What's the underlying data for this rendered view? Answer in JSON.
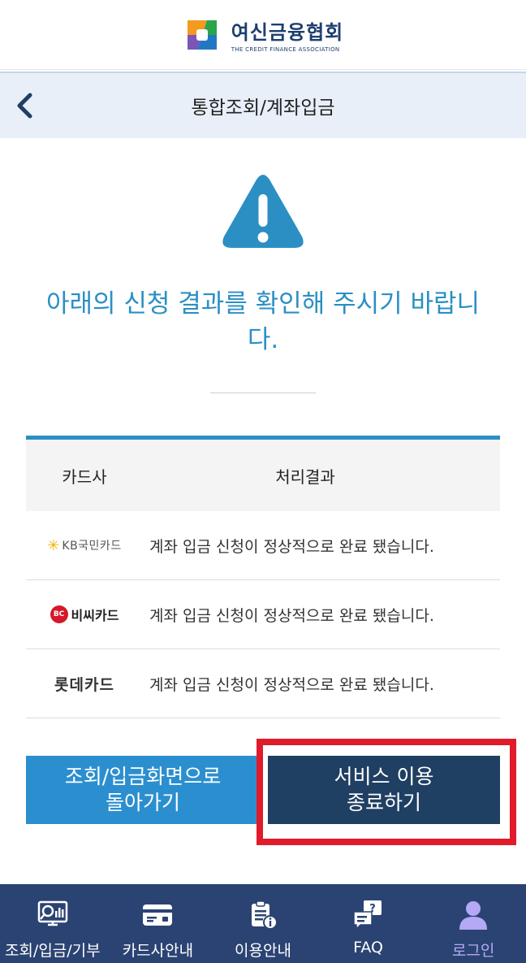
{
  "header": {
    "logo_ko": "여신금융협회",
    "logo_en": "THE CREDIT FINANCE ASSOCIATION"
  },
  "title_bar": {
    "title": "통합조회/계좌입금"
  },
  "message": "아래의 신청 결과를 확인해 주시기 바랍니다.",
  "table": {
    "headers": {
      "card": "카드사",
      "result": "처리결과"
    },
    "rows": [
      {
        "card": "KB국민카드",
        "result": "계좌 입금 신청이 정상적으로 완료 됐습니다."
      },
      {
        "card": "비씨카드",
        "result": "계좌 입금 신청이 정상적으로 완료 됐습니다."
      },
      {
        "card": "롯데카드",
        "result": "계좌 입금 신청이 정상적으로 완료 됐습니다."
      }
    ]
  },
  "buttons": {
    "back_line1": "조회/입금화면으로",
    "back_line2": "돌아가기",
    "exit_line1": "서비스 이용",
    "exit_line2": "종료하기"
  },
  "bottom_nav": [
    {
      "label": "조회/입금/기부",
      "icon": "search-chart-icon"
    },
    {
      "label": "카드사안내",
      "icon": "credit-card-icon"
    },
    {
      "label": "이용안내",
      "icon": "clipboard-info-icon"
    },
    {
      "label": "FAQ",
      "icon": "faq-chat-icon"
    },
    {
      "label": "로그인",
      "icon": "user-icon",
      "active": true
    }
  ],
  "colors": {
    "accent": "#2b8fc4",
    "primary_dark": "#1f3f63",
    "nav_bg": "#2b4372",
    "highlight": "#e01b2a",
    "active_nav": "#b3a9f5"
  }
}
